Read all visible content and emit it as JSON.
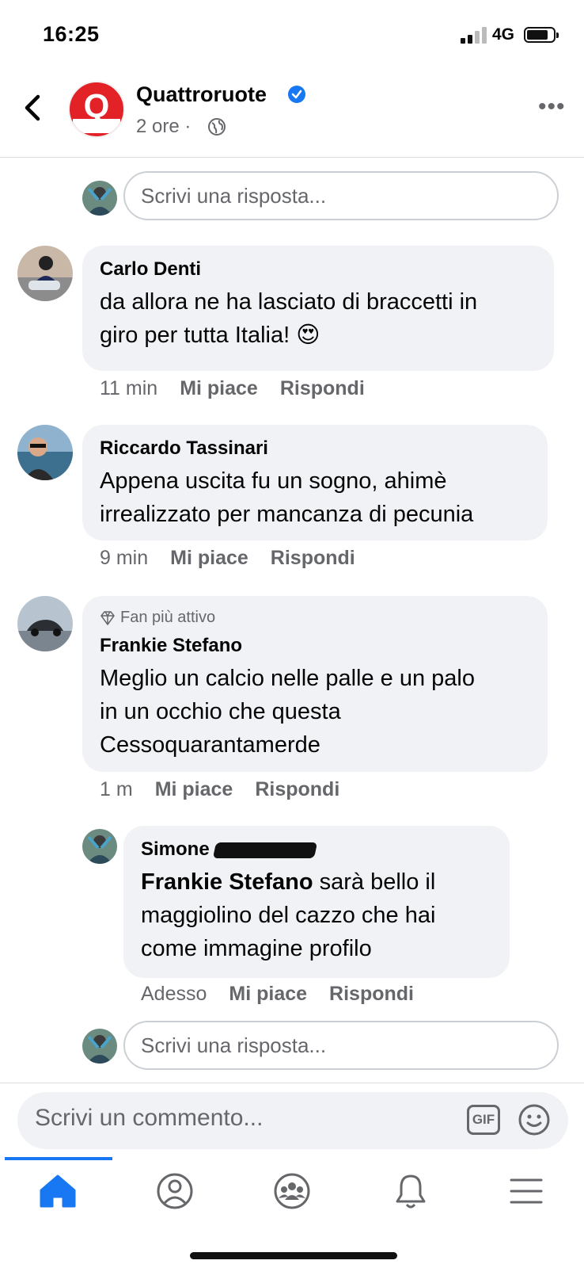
{
  "status_bar": {
    "time": "16:25",
    "network": "4G"
  },
  "header": {
    "page_name": "Quattroruote",
    "post_time": "2 ore ·",
    "logo_letter": "Q"
  },
  "reply_placeholder": "Scrivi una risposta...",
  "comments": [
    {
      "author": "Carlo Denti",
      "line1": "da allora ne ha lasciato di braccetti in",
      "line2": "giro per tutta Italia! 😍",
      "time": "11 min",
      "like": "Mi piace",
      "reply": "Rispondi"
    },
    {
      "author": "Riccardo Tassinari",
      "line1": "Appena uscita fu un sogno, ahimè",
      "line2": "irrealizzato per mancanza di pecunia",
      "time": "9 min",
      "like": "Mi piace",
      "reply": "Rispondi"
    },
    {
      "badge": "Fan più attivo",
      "author": "Frankie Stefano",
      "line1": "Meglio un calcio nelle palle e un palo",
      "line2": "in un occhio che questa",
      "line3": "Cessoquarantamerde",
      "time": "1 m",
      "like": "Mi piace",
      "reply": "Rispondi"
    }
  ],
  "reply": {
    "author": "Simone",
    "mention": "Frankie Stefano",
    "line1_rest": " sarà bello il",
    "line2": "maggiolino del cazzo che hai",
    "line3": "come immagine profilo",
    "time": "Adesso",
    "like": "Mi piace",
    "reply": "Rispondi"
  },
  "comment_bar": {
    "placeholder": "Scrivi un commento...",
    "gif": "GIF"
  },
  "tabs": [
    "home",
    "profile",
    "groups",
    "notifications",
    "menu"
  ],
  "colors": {
    "accent": "#1877f2",
    "bubble": "#f0f2f5",
    "muted": "#65676b"
  }
}
